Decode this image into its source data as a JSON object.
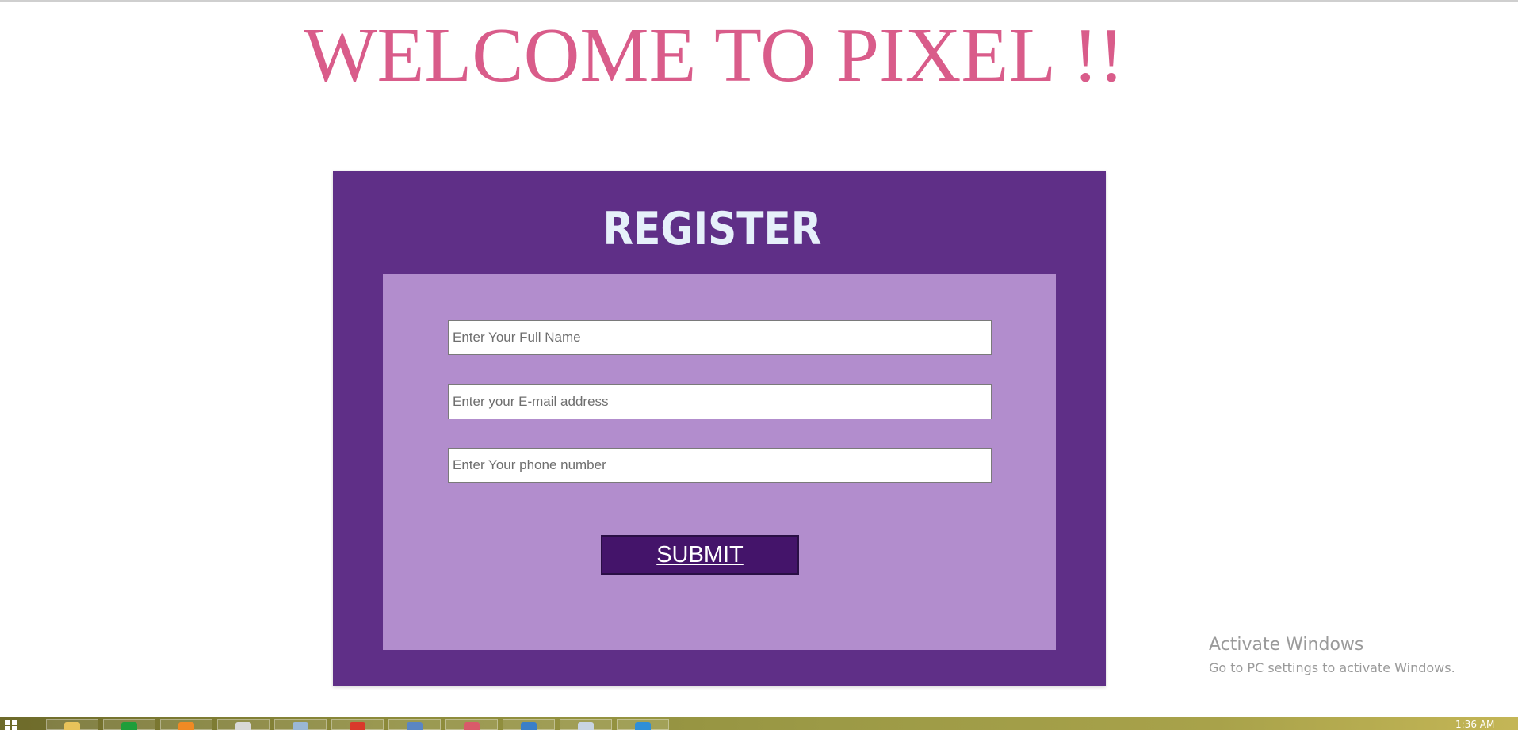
{
  "page": {
    "welcome_title": "WELCOME TO PIXEL !!"
  },
  "form": {
    "heading": "REGISTER",
    "full_name": {
      "placeholder": "Enter Your Full Name",
      "value": ""
    },
    "email": {
      "placeholder": "Enter your E-mail address",
      "value": ""
    },
    "phone": {
      "placeholder": "Enter Your phone number",
      "value": ""
    },
    "submit_label": "SUBMIT"
  },
  "watermark": {
    "title": "Activate Windows",
    "subtitle": "Go to PC settings to activate Windows."
  },
  "taskbar": {
    "clock": "1:36 AM",
    "apps": [
      {
        "icon": "file-explorer-icon",
        "color": "#e8c35a"
      },
      {
        "icon": "store-icon",
        "color": "#1f9e3a"
      },
      {
        "icon": "firefox-icon",
        "color": "#f08a24"
      },
      {
        "icon": "chrome-icon",
        "color": "#d8d8d8"
      },
      {
        "icon": "window-app-icon",
        "color": "#9ab8d6"
      },
      {
        "icon": "record-app-icon",
        "color": "#d9392b"
      },
      {
        "icon": "browser-window-icon",
        "color": "#5a86c4"
      },
      {
        "icon": "eraser-app-icon",
        "color": "#d95a6a"
      },
      {
        "icon": "monitor-app-icon",
        "color": "#3a7fc8"
      },
      {
        "icon": "document-app-icon",
        "color": "#c8d4e2"
      },
      {
        "icon": "vscode-icon",
        "color": "#2f8fd8"
      }
    ]
  },
  "colors": {
    "welcome_text": "#d95c8a",
    "card_outer": "#5f2f87",
    "card_inner": "#b28dcd",
    "heading_text": "#e6f0fa",
    "submit_bg": "#44146a"
  }
}
